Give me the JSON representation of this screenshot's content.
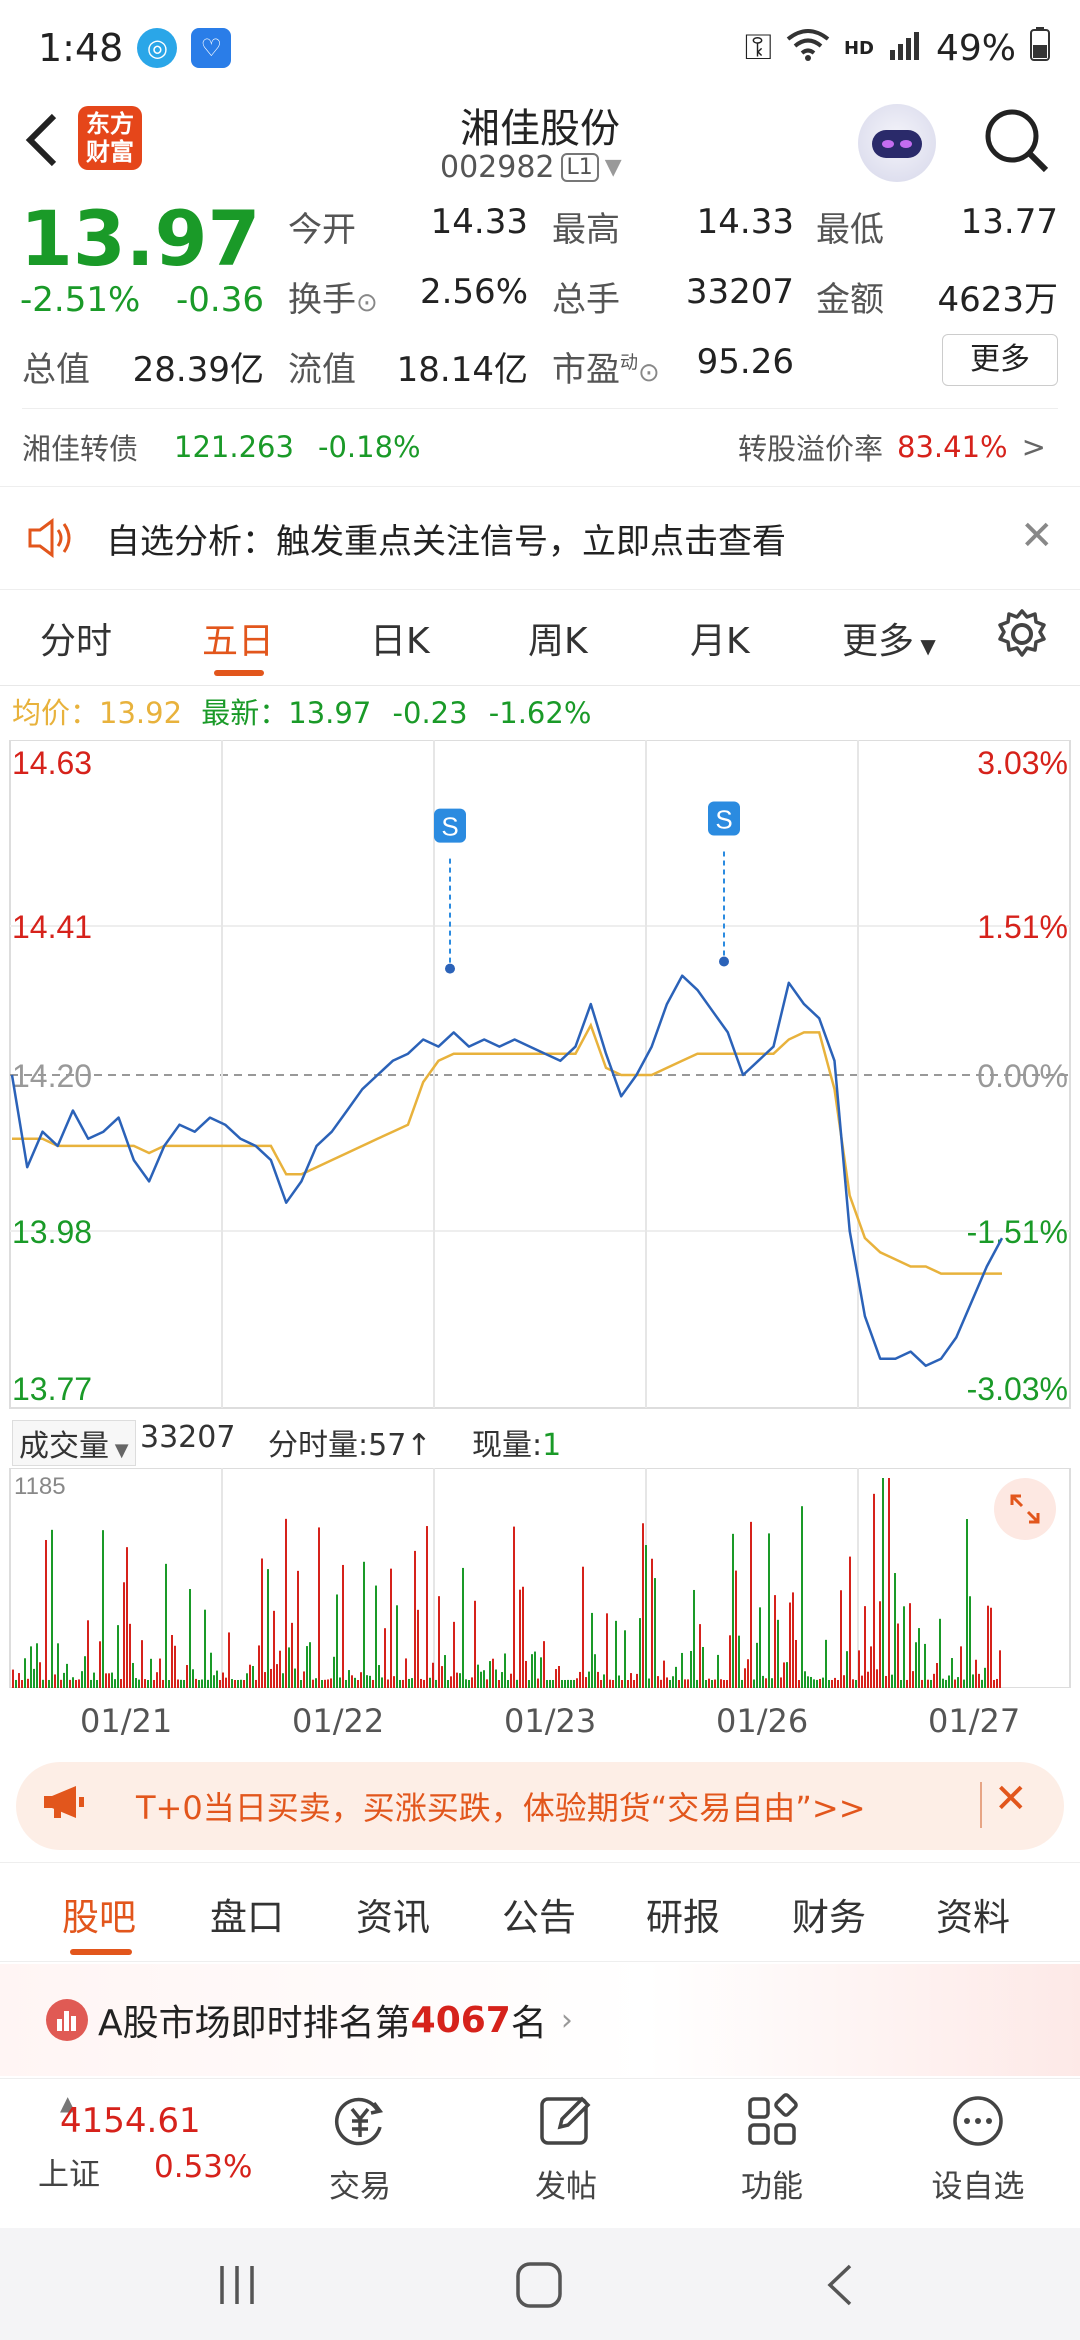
{
  "status": {
    "time": "1:48",
    "battery": "49%",
    "hd": "HD"
  },
  "header": {
    "logo_text": "东方财富",
    "stock_name": "湘佳股份",
    "stock_code": "002982",
    "level_badge": "L1"
  },
  "quote": {
    "price": "13.97",
    "change_pct": "-2.51%",
    "change_amt": "-0.36",
    "open_label": "今开",
    "open": "14.33",
    "high_label": "最高",
    "high": "14.33",
    "low_label": "最低",
    "low": "13.77",
    "turnover_label": "换手",
    "turnover": "2.56%",
    "volume_label": "总手",
    "volume": "33207",
    "amount_label": "金额",
    "amount": "4623万",
    "mktcap_label": "总值",
    "mktcap": "28.39亿",
    "float_label": "流值",
    "float": "18.14亿",
    "pe_label": "市盈",
    "pe_sup": "动",
    "pe": "95.26",
    "more_button": "更多",
    "bond_name": "湘佳转债",
    "bond_price": "121.263",
    "bond_change": "-0.18%",
    "premium_label": "转股溢价率",
    "premium_value": "83.41%",
    "premium_arrow": ">"
  },
  "notice": {
    "text": "自选分析：触发重点关注信号，立即点击查看"
  },
  "ktabs": [
    "分时",
    "五日",
    "日K",
    "周K",
    "月K",
    "更多"
  ],
  "ktab_active": "五日",
  "infobar": {
    "avg_label": "均价：",
    "avg": "13.92",
    "latest_label": "最新：",
    "latest": "13.97",
    "chg": "-0.23",
    "chg_pct": "-1.62%"
  },
  "chart_data": {
    "type": "line",
    "y_left_labels": [
      "14.63",
      "14.41",
      "14.20",
      "13.98",
      "13.77"
    ],
    "y_right_labels": [
      "3.03%",
      "1.51%",
      "0.00%",
      "-1.51%",
      "-3.03%"
    ],
    "x_labels": [
      "01/21",
      "01/22",
      "01/23",
      "01/26",
      "01/27"
    ],
    "ylim": [
      13.77,
      14.63
    ],
    "prev_close": 14.2,
    "series": [
      {
        "values": [
          14.2,
          14.07,
          14.12,
          14.1,
          14.15,
          14.11,
          14.12,
          14.14,
          14.08,
          14.05,
          14.1,
          14.13,
          14.12,
          14.14,
          14.13,
          14.11,
          14.1,
          14.08,
          14.02,
          14.05,
          14.1,
          14.12,
          14.15,
          14.18,
          14.2,
          14.22,
          14.23,
          14.25,
          14.24,
          14.26,
          14.24,
          14.25,
          14.24,
          14.25,
          14.24,
          14.23,
          14.22,
          14.24,
          14.3,
          14.23,
          14.17,
          14.2,
          14.24,
          14.3,
          14.34,
          14.32,
          14.29,
          14.26,
          14.2,
          14.22,
          14.24,
          14.33,
          14.3,
          14.28,
          14.22,
          13.98,
          13.86,
          13.8,
          13.8,
          13.81,
          13.79,
          13.8,
          13.83,
          13.88,
          13.93,
          13.97
        ]
      },
      {
        "values": [
          14.11,
          14.11,
          14.11,
          14.1,
          14.1,
          14.1,
          14.1,
          14.1,
          14.1,
          14.09,
          14.1,
          14.1,
          14.1,
          14.1,
          14.1,
          14.1,
          14.1,
          14.1,
          14.06,
          14.06,
          14.07,
          14.08,
          14.09,
          14.1,
          14.11,
          14.12,
          14.13,
          14.19,
          14.22,
          14.23,
          14.23,
          14.23,
          14.23,
          14.23,
          14.23,
          14.23,
          14.23,
          14.23,
          14.27,
          14.21,
          14.2,
          14.2,
          14.2,
          14.21,
          14.22,
          14.23,
          14.23,
          14.23,
          14.23,
          14.23,
          14.23,
          14.25,
          14.26,
          14.26,
          14.18,
          14.03,
          13.97,
          13.95,
          13.94,
          13.93,
          13.93,
          13.92,
          13.92,
          13.92,
          13.92,
          13.92
        ]
      }
    ],
    "signals": [
      "S",
      "S"
    ]
  },
  "volume": {
    "label": "成交量",
    "total": "33207",
    "minute_label": "分时量:",
    "minute": "57",
    "cur_label": "现量:",
    "cur": "1",
    "ymax": "1185"
  },
  "promo": {
    "text": "T+0当日买卖，买涨买跌，体验期货“交易自由”>>"
  },
  "btabs": [
    "股吧",
    "盘口",
    "资讯",
    "公告",
    "研报",
    "财务",
    "资料"
  ],
  "btab_active": "股吧",
  "rank": {
    "prefix": "A股市场即时排名第",
    "number": "4067",
    "suffix": "名"
  },
  "bottomnav": {
    "index_value": "4154.61",
    "index_name": "上证",
    "index_change": "0.53%",
    "items": [
      "交易",
      "发帖",
      "功能",
      "设自选"
    ]
  },
  "colors": {
    "up": "#d6221b",
    "down": "#1a9a28",
    "accent": "#e2561c",
    "line": "#2b62b8",
    "avg": "#e8b23c"
  }
}
